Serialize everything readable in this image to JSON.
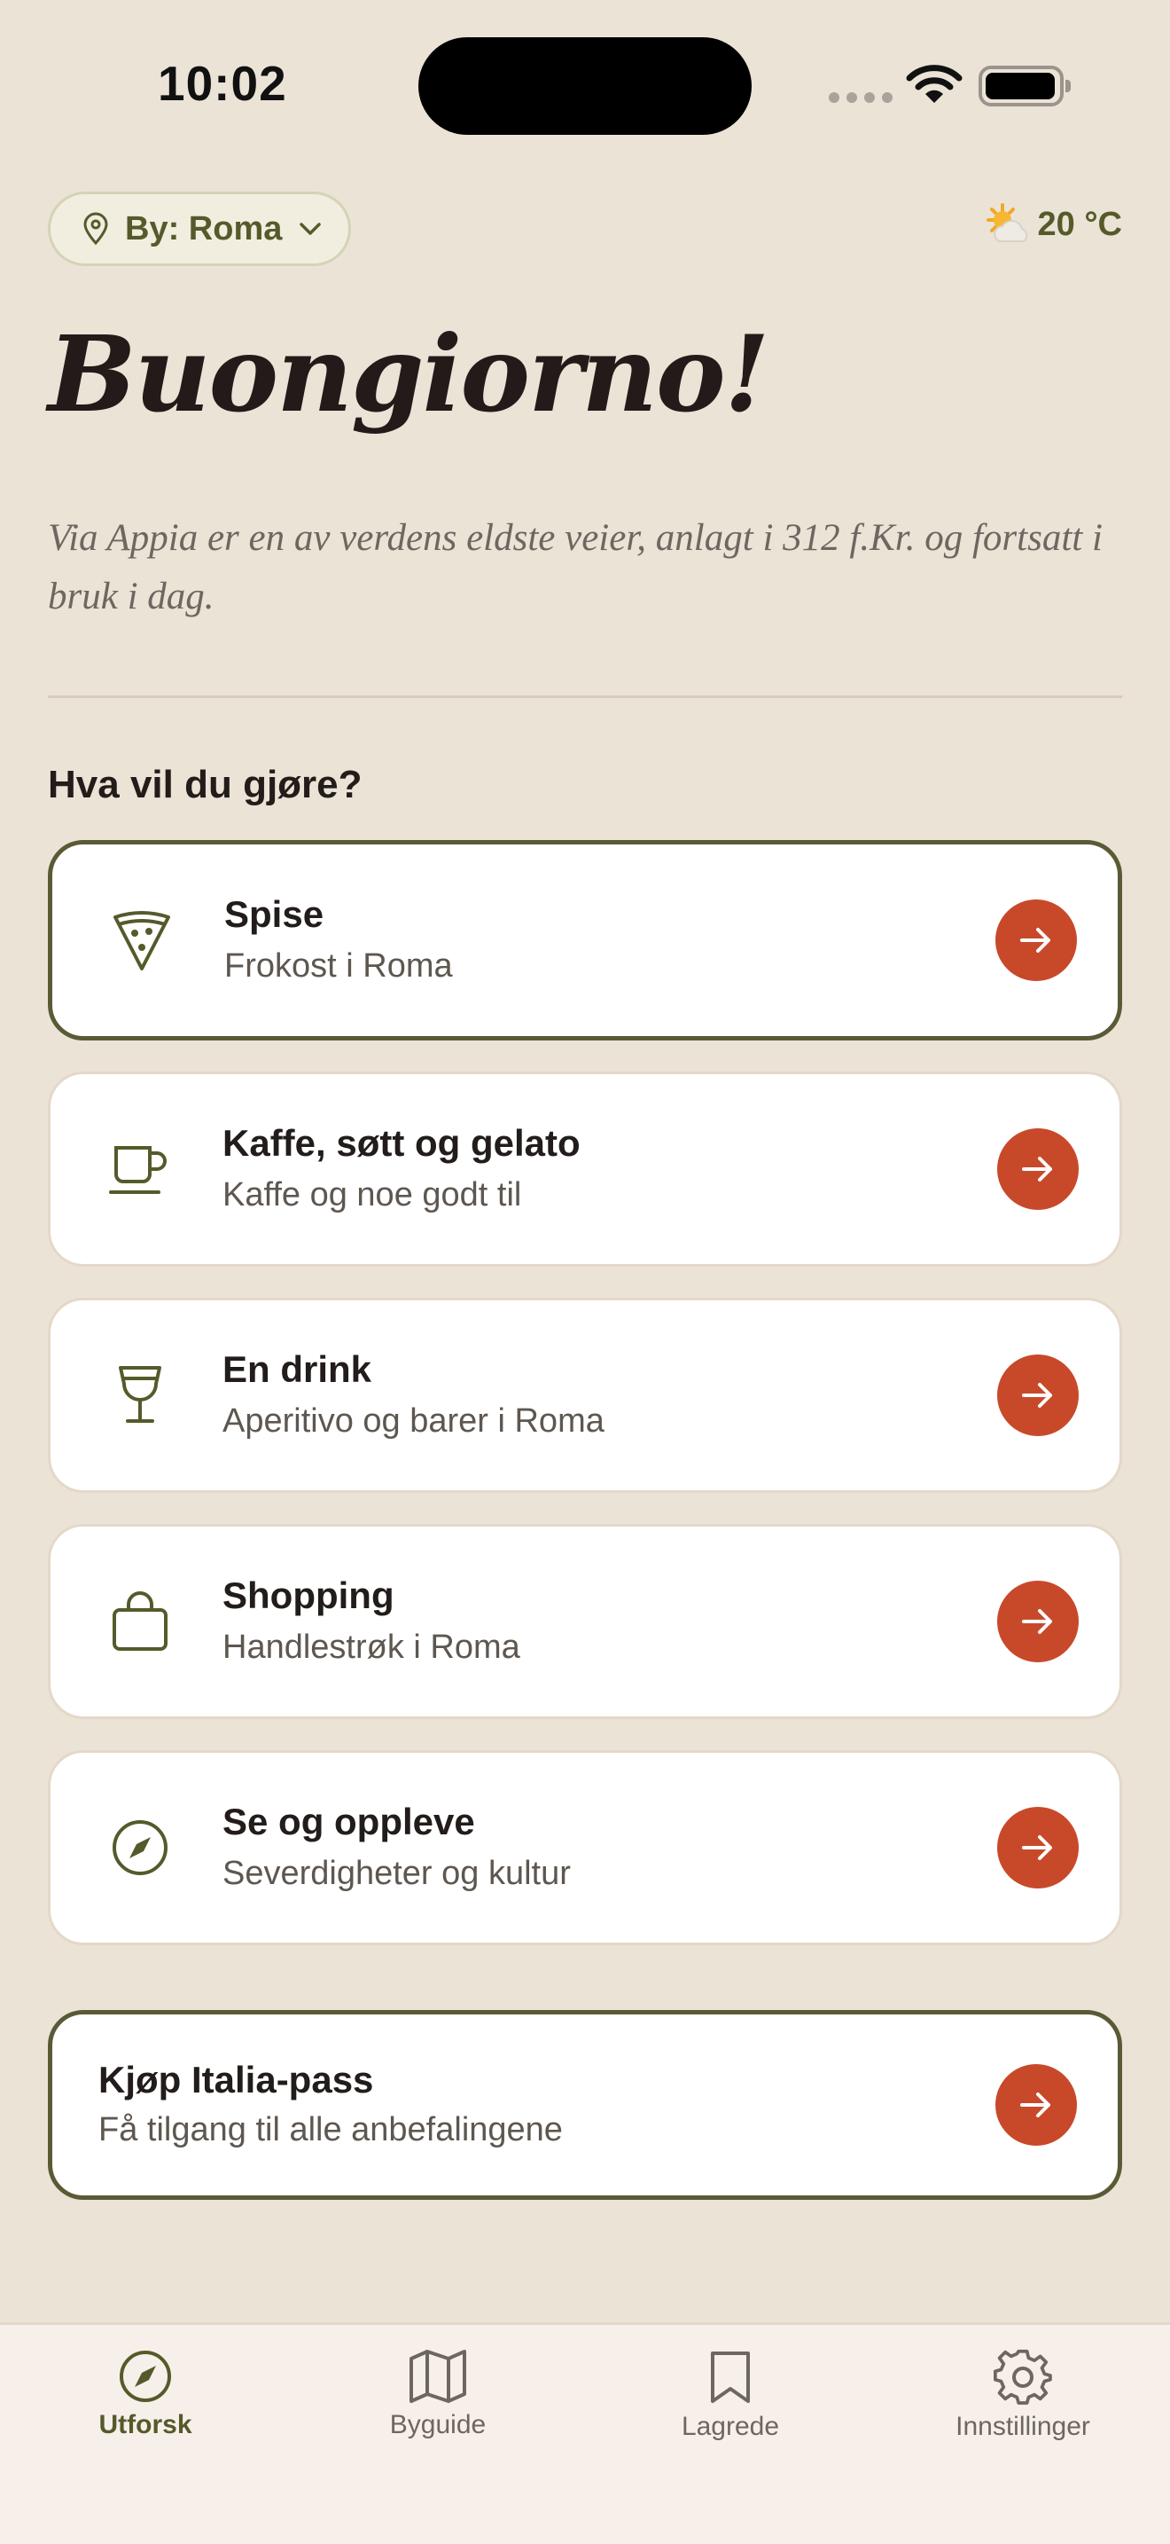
{
  "status_bar": {
    "time": "10:02"
  },
  "header": {
    "city_label": "By: Roma",
    "temperature": "20 °C",
    "weather_icon": "sun-behind-cloud-icon"
  },
  "greeting": "Buongiorno!",
  "fact": "Via Appia er en av verdens eldste veier, anlagt i 312 f.Kr. og fortsatt i bruk i dag.",
  "section_title": "Hva vil du gjøre?",
  "categories": [
    {
      "title": "Spise",
      "subtitle": "Frokost i Roma",
      "icon": "pizza-slice-icon"
    },
    {
      "title": "Kaffe, søtt og gelato",
      "subtitle": "Kaffe og noe godt til",
      "icon": "coffee-cup-icon"
    },
    {
      "title": "En drink",
      "subtitle": "Aperitivo og barer i Roma",
      "icon": "wine-glass-icon"
    },
    {
      "title": "Shopping",
      "subtitle": "Handlestrøk i Roma",
      "icon": "shopping-bag-icon"
    },
    {
      "title": "Se og oppleve",
      "subtitle": "Severdigheter og kultur",
      "icon": "compass-icon"
    }
  ],
  "pass": {
    "title": "Kjøp Italia-pass",
    "subtitle": "Få tilgang til alle anbefalingene"
  },
  "tabs": [
    {
      "label": "Utforsk",
      "icon": "compass-icon",
      "active": true
    },
    {
      "label": "Byguide",
      "icon": "map-icon",
      "active": false
    },
    {
      "label": "Lagrede",
      "icon": "bookmark-icon",
      "active": false
    },
    {
      "label": "Innstillinger",
      "icon": "gear-icon",
      "active": false
    }
  ],
  "colors": {
    "background": "#ebe3d6",
    "accent": "#c8492a",
    "olive": "#565a2b",
    "card": "#ffffff"
  }
}
